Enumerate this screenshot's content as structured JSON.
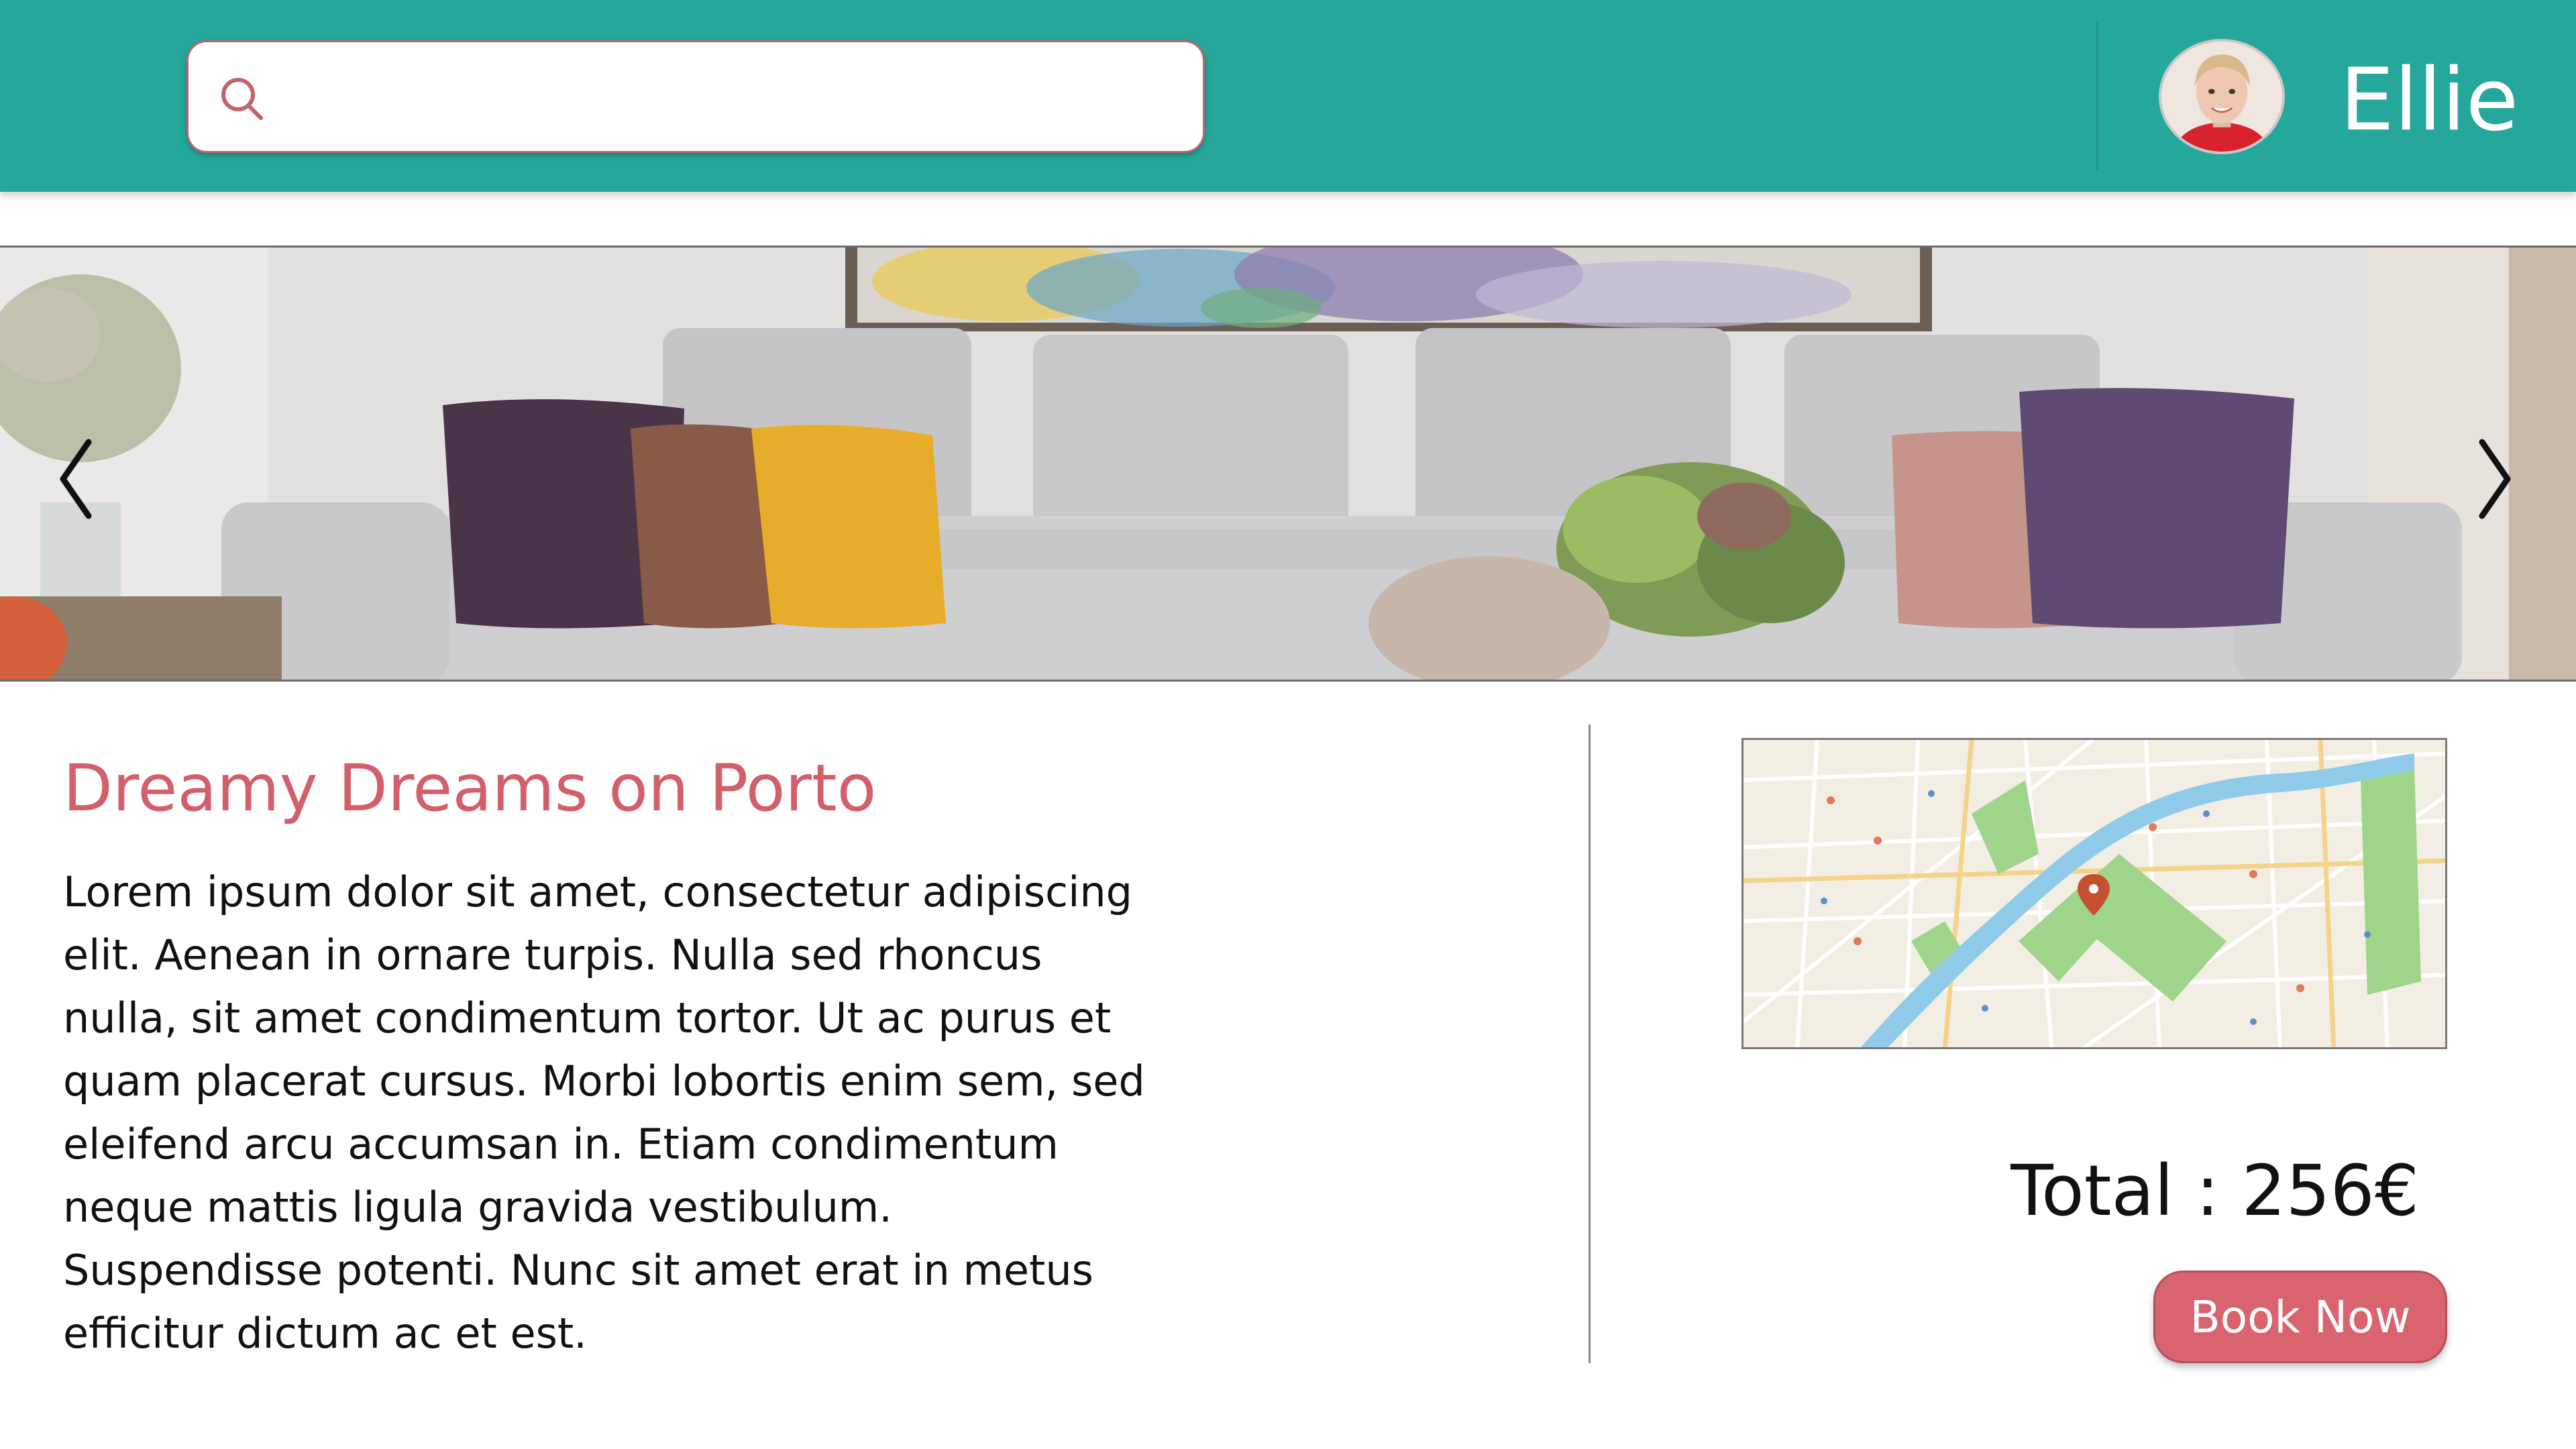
{
  "header": {
    "search_placeholder": "",
    "user_name": "Ellie"
  },
  "listing": {
    "title": "Dreamy Dreams on Porto",
    "description": "Lorem ipsum dolor sit amet, consectetur adipiscing elit. Aenean in ornare turpis. Nulla sed rhoncus nulla, sit amet condimentum tortor. Ut ac purus et quam placerat cursus. Morbi lobortis enim sem, sed eleifend arcu accumsan in. Etiam condimentum neque mattis ligula gravida vestibulum. Suspendisse potenti. Nunc sit amet erat in metus efficitur dictum ac et est."
  },
  "booking": {
    "total_label": "Total : 256€",
    "book_button": "Book Now"
  },
  "icons": {
    "search": "search-icon",
    "prev": "chevron-left-icon",
    "next": "chevron-right-icon",
    "map_pin": "map-pin-icon"
  },
  "colors": {
    "header_bg": "#26a79b",
    "accent": "#d9646f",
    "title": "#d25f6a"
  }
}
